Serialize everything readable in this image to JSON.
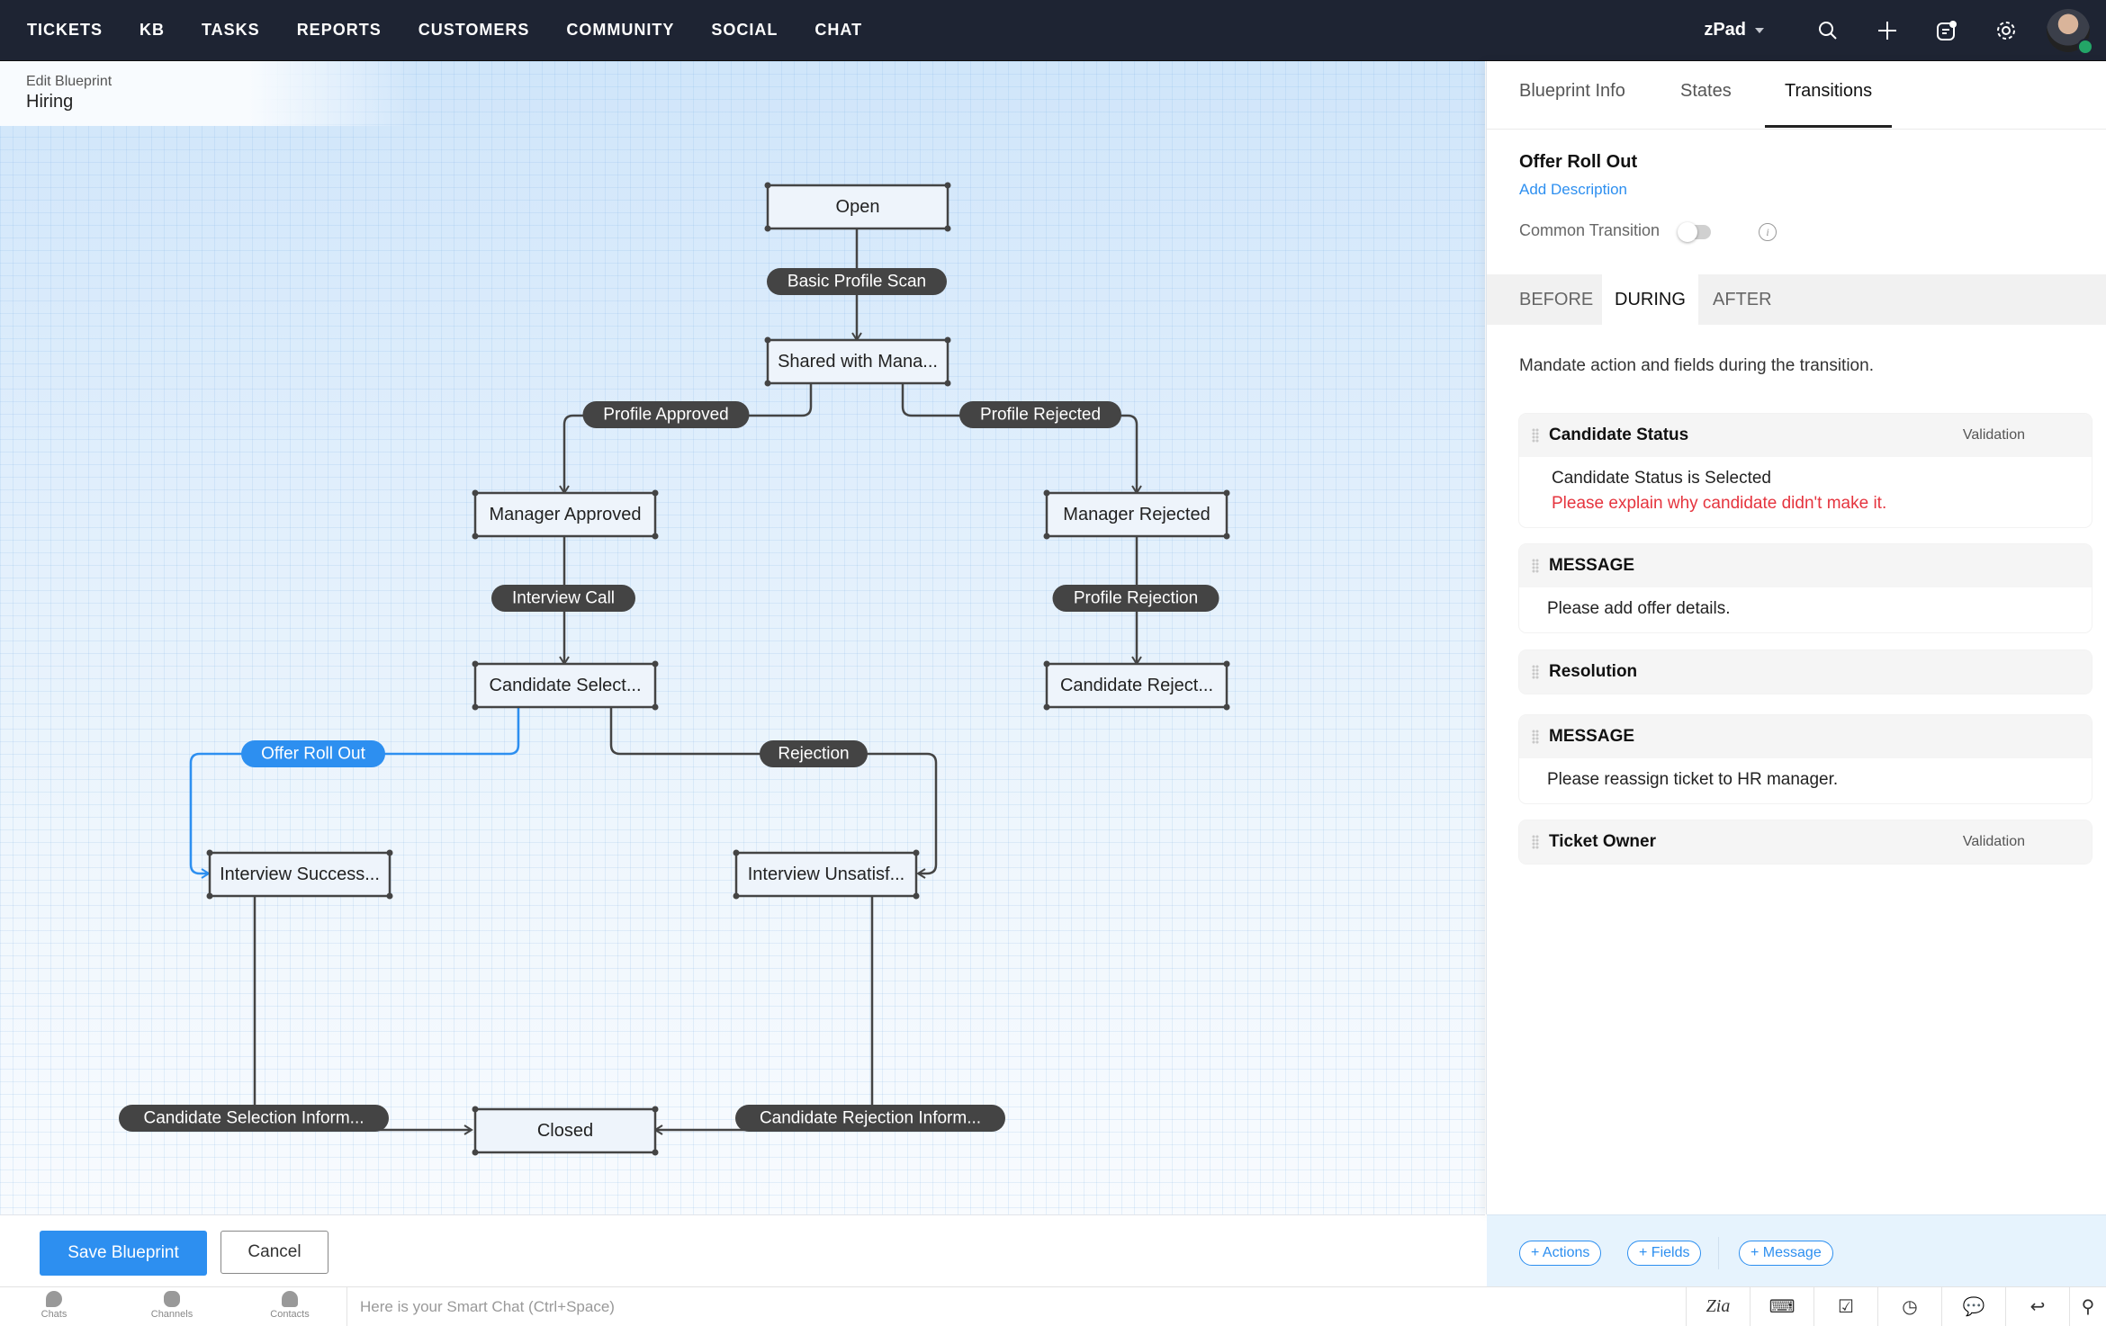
{
  "topnav": {
    "items": [
      "TICKETS",
      "KB",
      "TASKS",
      "REPORTS",
      "CUSTOMERS",
      "COMMUNITY",
      "SOCIAL",
      "CHAT"
    ],
    "workspace": "zPad",
    "icons": [
      "search-icon",
      "plus-icon",
      "notes-icon",
      "gear-icon"
    ],
    "status_color": "#23a567"
  },
  "breadcrumb": {
    "label": "Edit Blueprint",
    "name": "Hiring"
  },
  "diagram": {
    "states": [
      {
        "id": "open",
        "label": "Open"
      },
      {
        "id": "shared",
        "label": "Shared with Mana..."
      },
      {
        "id": "mgr_approved",
        "label": "Manager Approved"
      },
      {
        "id": "mgr_rejected",
        "label": "Manager Rejected"
      },
      {
        "id": "cand_selected",
        "label": "Candidate Select..."
      },
      {
        "id": "cand_rejected",
        "label": "Candidate Reject..."
      },
      {
        "id": "int_success",
        "label": "Interview Success..."
      },
      {
        "id": "int_unsat",
        "label": "Interview Unsatisf..."
      },
      {
        "id": "closed",
        "label": "Closed"
      }
    ],
    "transitions": [
      {
        "id": "t1",
        "label": "Basic Profile Scan",
        "from": "open",
        "to": "shared"
      },
      {
        "id": "t2",
        "label": "Profile Approved",
        "from": "shared",
        "to": "mgr_approved"
      },
      {
        "id": "t3",
        "label": "Profile Rejected",
        "from": "shared",
        "to": "mgr_rejected"
      },
      {
        "id": "t4",
        "label": "Interview Call",
        "from": "mgr_approved",
        "to": "cand_selected"
      },
      {
        "id": "t5",
        "label": "Profile Rejection",
        "from": "mgr_rejected",
        "to": "cand_rejected"
      },
      {
        "id": "t6",
        "label": "Offer Roll Out",
        "from": "cand_selected",
        "to": "int_success",
        "selected": true
      },
      {
        "id": "t7",
        "label": "Rejection",
        "from": "cand_selected",
        "to": "int_unsat"
      },
      {
        "id": "t8",
        "label": "Candidate Selection Inform...",
        "from": "int_success",
        "to": "closed"
      },
      {
        "id": "t9",
        "label": "Candidate Rejection Inform...",
        "from": "int_unsat",
        "to": "closed"
      }
    ],
    "accent_color": "#2d8ff0"
  },
  "actions": {
    "save": "Save Blueprint",
    "cancel": "Cancel"
  },
  "panel": {
    "tabs": [
      "Blueprint Info",
      "States",
      "Transitions"
    ],
    "active_tab": "Transitions",
    "transition_name": "Offer Roll Out",
    "add_description": "Add Description",
    "common_transition_label": "Common Transition",
    "common_transition_on": false,
    "phases": [
      "BEFORE",
      "DURING",
      "AFTER"
    ],
    "active_phase": "DURING",
    "phase_description": "Mandate action and fields during the transition.",
    "cards": [
      {
        "title": "Candidate Status",
        "tag": "Validation",
        "lines": [
          "Candidate Status is  Selected"
        ],
        "error": "Please explain why candidate didn't make it."
      },
      {
        "title": "MESSAGE",
        "message": "Please add offer details."
      },
      {
        "title": "Resolution"
      },
      {
        "title": "MESSAGE",
        "message": "Please reassign ticket to HR manager."
      },
      {
        "title": "Ticket Owner",
        "tag": "Validation"
      }
    ],
    "footer_buttons": [
      "+ Actions",
      "+ Fields",
      "+ Message"
    ]
  },
  "statusbar": {
    "items": [
      "Chats",
      "Channels",
      "Contacts"
    ],
    "smart_chat_placeholder": "Here is your Smart Chat (Ctrl+Space)",
    "right_icons": [
      "zia-icon",
      "keyboard-icon",
      "task-check-icon",
      "clock-icon",
      "chat-bubbles-icon",
      "reply-icon",
      "search-icon"
    ]
  }
}
